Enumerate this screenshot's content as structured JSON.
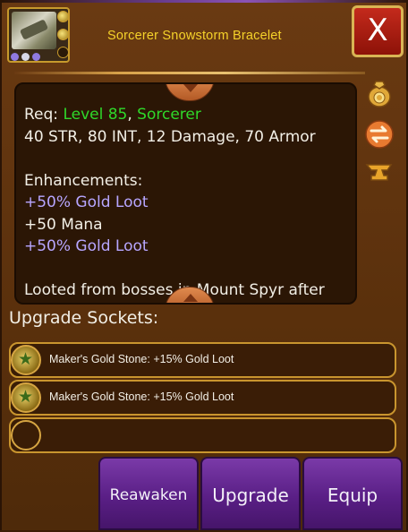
{
  "item": {
    "name": "Sorcerer Snowstorm Bracelet",
    "icon": "bracelet-icon",
    "gem_slots": [
      "filled",
      "filled",
      "empty"
    ],
    "rarity_dots": [
      "#8f7ae0",
      "#d8d8e8",
      "#8f7ae0"
    ]
  },
  "close_label": "X",
  "description": {
    "req_label": "Req:",
    "req_level": "Level 85",
    "req_sep": ",",
    "req_class": "Sorcerer",
    "stats": "40 STR, 80 INT, 12 Damage, 70 Armor",
    "enhancements_title": "Enhancements:",
    "enhancements": [
      {
        "text": "+50% Gold Loot",
        "color": "#b7a6ff"
      },
      {
        "text": "+50 Mana",
        "color": "#f2efe6"
      },
      {
        "text": "+50% Gold Loot",
        "color": "#b7a6ff"
      }
    ],
    "lore": "Looted from bosses in Mount Spyr after"
  },
  "side_icons": [
    "gold-bag-icon",
    "swap-icon",
    "anvil-icon"
  ],
  "sockets": {
    "title": "Upgrade Sockets:",
    "rows": [
      {
        "text": "Maker's Gold Stone: +15% Gold Loot",
        "filled": true
      },
      {
        "text": "Maker's Gold Stone: +15% Gold Loot",
        "filled": true
      },
      {
        "text": "",
        "filled": false
      }
    ]
  },
  "buttons": {
    "reawaken": "Reawaken",
    "upgrade": "Upgrade",
    "equip": "Equip"
  }
}
